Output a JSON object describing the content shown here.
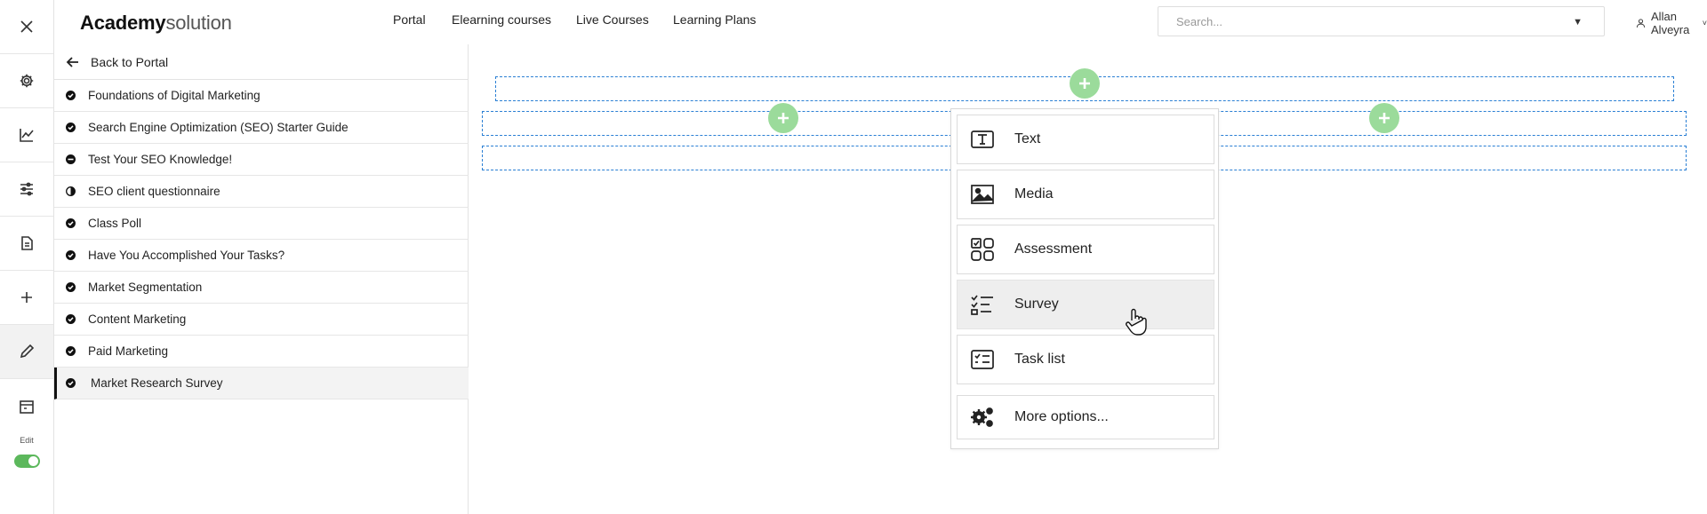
{
  "app": {
    "logo_bold": "Academy",
    "logo_light": "solution"
  },
  "nav": {
    "items": [
      "Portal",
      "Elearning courses",
      "Live Courses",
      "Learning Plans"
    ]
  },
  "search": {
    "placeholder": "Search..."
  },
  "user": {
    "name": "Allan Alveyra"
  },
  "rail": {
    "icons": [
      "close-icon",
      "settings-icon",
      "chart-icon",
      "sliders-icon",
      "document-icon",
      "plus-icon",
      "pen-icon",
      "calendar-icon"
    ],
    "edit_label": "Edit",
    "edit_enabled": true,
    "active_icon": "pen-icon"
  },
  "sidebar": {
    "back_label": "Back to Portal",
    "items": [
      {
        "label": "Foundations of Digital Marketing",
        "status": "complete"
      },
      {
        "label": "Search Engine Optimization (SEO) Starter Guide",
        "status": "complete"
      },
      {
        "label": "Test Your SEO Knowledge!",
        "status": "blocked"
      },
      {
        "label": "SEO client questionnaire",
        "status": "half"
      },
      {
        "label": "Class Poll",
        "status": "complete"
      },
      {
        "label": "Have You Accomplished Your Tasks?",
        "status": "complete"
      },
      {
        "label": "Market Segmentation",
        "status": "complete"
      },
      {
        "label": "Content Marketing",
        "status": "complete"
      },
      {
        "label": "Paid Marketing",
        "status": "complete"
      },
      {
        "label": "Market Research Survey",
        "status": "complete",
        "selected": true
      }
    ]
  },
  "add_menu": {
    "options": [
      {
        "label": "Text",
        "icon": "text-icon"
      },
      {
        "label": "Media",
        "icon": "image-icon"
      },
      {
        "label": "Assessment",
        "icon": "assessment-icon"
      },
      {
        "label": "Survey",
        "icon": "survey-icon",
        "hovered": true
      },
      {
        "label": "Task list",
        "icon": "task-list-icon"
      },
      {
        "label": "More options...",
        "icon": "gears-icon"
      }
    ]
  },
  "colors": {
    "accent_green": "#9bdb9b",
    "toggle_green": "#5cb85c",
    "dash_blue": "#2a7fd4"
  }
}
